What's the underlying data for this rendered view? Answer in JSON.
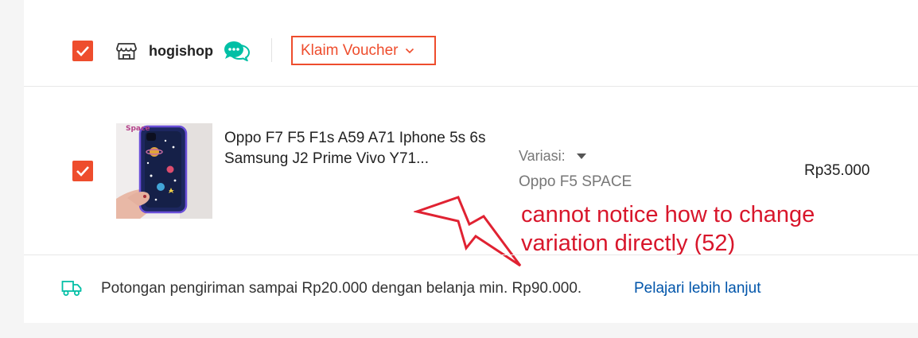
{
  "shop": {
    "name": "hogishop",
    "voucher_label": "Klaim Voucher"
  },
  "product": {
    "title": "Oppo F7 F5 F1s A59 A71 Iphone 5s 6s Samsung J2 Prime Vivo Y71...",
    "image_caption": "Space",
    "variation_label": "Variasi:",
    "variation_value": "Oppo F5 SPACE",
    "price": "Rp35.000",
    "selected": true
  },
  "annotation": {
    "line1": "cannot notice how to change",
    "line2": "variation directly (52)"
  },
  "shipping": {
    "text": "Potongan pengiriman sampai Rp20.000 dengan belanja min. Rp90.000.",
    "link": "Pelajari lebih lanjut"
  },
  "colors": {
    "accent": "#ee4d2d",
    "chat": "#00bfa5",
    "link": "#0055aa",
    "annotation": "#d8162b"
  }
}
